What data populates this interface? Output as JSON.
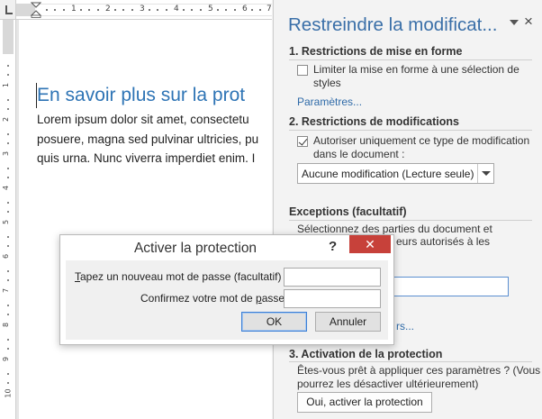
{
  "ruler": {
    "numbers": [
      "1",
      "2",
      "3",
      "4",
      "5",
      "6",
      "7"
    ],
    "v_numbers": [
      "1",
      "2",
      "3",
      "4",
      "5",
      "6",
      "7",
      "8",
      "9",
      "10"
    ]
  },
  "document": {
    "heading": "En savoir plus sur la prot",
    "lines": [
      "Lorem ipsum dolor sit amet, consectetu",
      "posuere, magna sed pulvinar ultricies, pu",
      "quis urna. Nunc viverra imperdiet enim. I"
    ]
  },
  "pane": {
    "title": "Restreindre la modificat...",
    "close": "×",
    "section1": {
      "heading": "1. Restrictions de mise en forme",
      "checkbox_label_1": "Limiter la mise en forme à une sélection de",
      "checkbox_label_2": "styles",
      "checked": false,
      "settings_link": "Paramètres..."
    },
    "section2": {
      "heading": "2. Restrictions de modifications",
      "checkbox_label_1": "Autoriser uniquement ce type de modification",
      "checkbox_label_2": "dans le document :",
      "checked": true,
      "select_value": "Aucune modification (Lecture seule)"
    },
    "exceptions": {
      "heading": "Exceptions (facultatif)",
      "text_1": "Sélectionnez des parties du document et",
      "text_2": "eurs autorisés à les",
      "link": "rs..."
    },
    "section3": {
      "heading": "3. Activation de la protection",
      "text_1": "Êtes-vous prêt à appliquer ces paramètres ? (Vous",
      "text_2": "pourrez les désactiver ultérieurement)",
      "button": "Oui, activer la protection"
    }
  },
  "dialog": {
    "title": "Activer la protection",
    "help": "?",
    "close": "✕",
    "password_label_prefix": "T",
    "password_label_rest": "apez un nouveau mot de passe (facultatif) :",
    "confirm_label_prefix": "Confirmez votre mot de ",
    "confirm_label_underlined": "p",
    "confirm_label_rest": "asse :",
    "password_value": "",
    "confirm_value": "",
    "ok": "OK",
    "cancel": "Annuler"
  }
}
